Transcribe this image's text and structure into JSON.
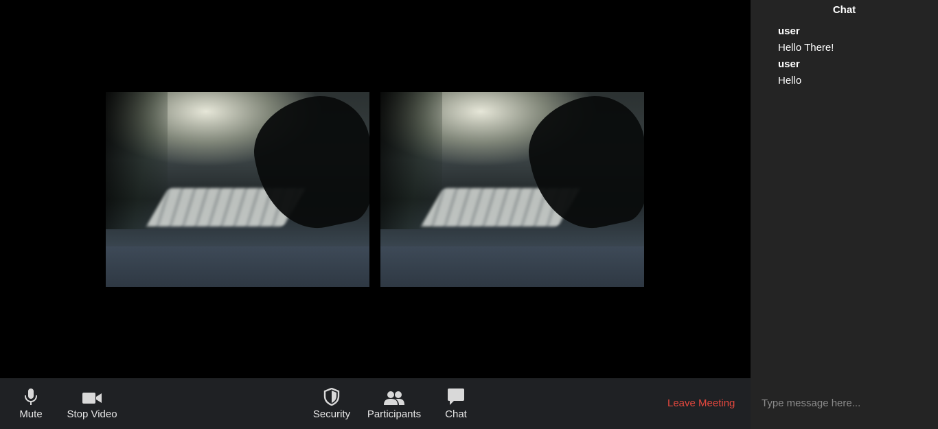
{
  "video_tiles": [
    {
      "id": "tile-1"
    },
    {
      "id": "tile-2"
    }
  ],
  "toolbar": {
    "mute_label": "Mute",
    "stop_video_label": "Stop Video",
    "security_label": "Security",
    "participants_label": "Participants",
    "chat_label": "Chat",
    "leave_label": "Leave Meeting",
    "icons": {
      "mute": "microphone-icon",
      "video": "video-camera-icon",
      "security": "shield-icon",
      "participants": "participants-icon",
      "chat": "chat-bubble-icon"
    },
    "leave_color": "#e5483e"
  },
  "chat": {
    "title": "Chat",
    "messages": [
      {
        "user": "user",
        "text": "Hello There!"
      },
      {
        "user": "user",
        "text": "Hello"
      }
    ],
    "input_placeholder": "Type message here..."
  }
}
